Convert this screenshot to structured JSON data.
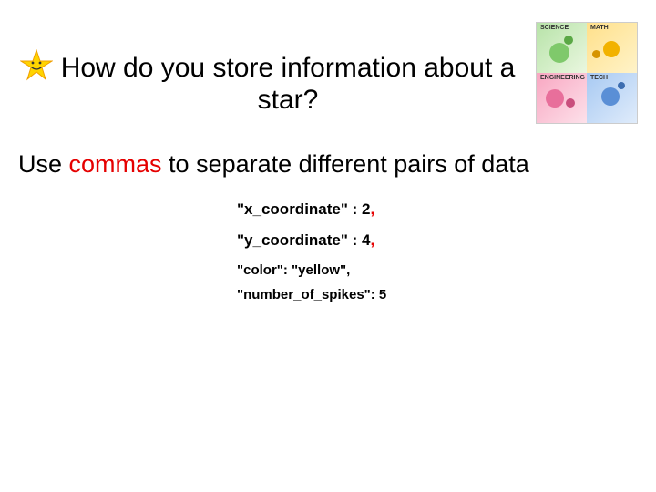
{
  "title": "How do you store information about a star?",
  "subtitle": {
    "prefix": "Use ",
    "highlight": "commas",
    "suffix": " to separate different pairs of data"
  },
  "code": {
    "line1_key": "\"x_coordinate\" : 2",
    "line1_comma": ",",
    "line2_key": "\"y_coordinate\" : 4",
    "line2_comma": ",",
    "line3": "\"color\": \"yellow\",",
    "line4": "\"number_of_spikes\": 5"
  },
  "corner_labels": {
    "p1": "SCIENCE",
    "p2": "MATH",
    "p3": "ENGINEERING",
    "p4": "TECH"
  }
}
